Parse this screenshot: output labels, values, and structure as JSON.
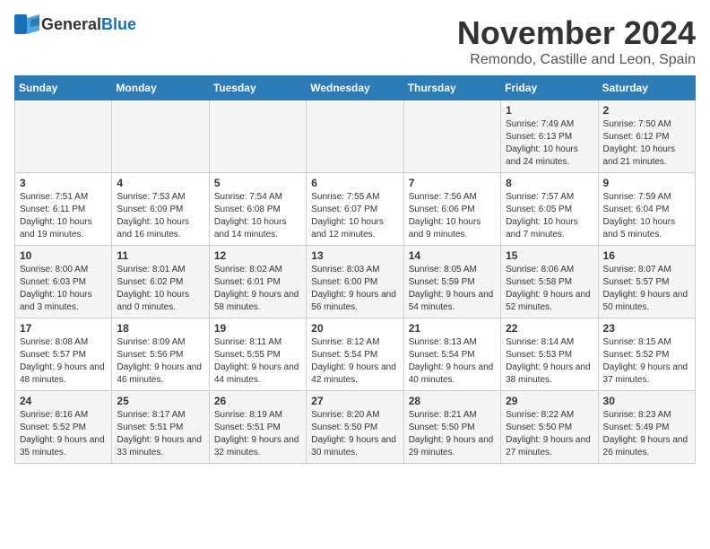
{
  "logo": {
    "general": "General",
    "blue": "Blue"
  },
  "title": "November 2024",
  "location": "Remondo, Castille and Leon, Spain",
  "days_of_week": [
    "Sunday",
    "Monday",
    "Tuesday",
    "Wednesday",
    "Thursday",
    "Friday",
    "Saturday"
  ],
  "weeks": [
    [
      {
        "day": "",
        "content": ""
      },
      {
        "day": "",
        "content": ""
      },
      {
        "day": "",
        "content": ""
      },
      {
        "day": "",
        "content": ""
      },
      {
        "day": "",
        "content": ""
      },
      {
        "day": "1",
        "content": "Sunrise: 7:49 AM\nSunset: 6:13 PM\nDaylight: 10 hours and 24 minutes."
      },
      {
        "day": "2",
        "content": "Sunrise: 7:50 AM\nSunset: 6:12 PM\nDaylight: 10 hours and 21 minutes."
      }
    ],
    [
      {
        "day": "3",
        "content": "Sunrise: 7:51 AM\nSunset: 6:11 PM\nDaylight: 10 hours and 19 minutes."
      },
      {
        "day": "4",
        "content": "Sunrise: 7:53 AM\nSunset: 6:09 PM\nDaylight: 10 hours and 16 minutes."
      },
      {
        "day": "5",
        "content": "Sunrise: 7:54 AM\nSunset: 6:08 PM\nDaylight: 10 hours and 14 minutes."
      },
      {
        "day": "6",
        "content": "Sunrise: 7:55 AM\nSunset: 6:07 PM\nDaylight: 10 hours and 12 minutes."
      },
      {
        "day": "7",
        "content": "Sunrise: 7:56 AM\nSunset: 6:06 PM\nDaylight: 10 hours and 9 minutes."
      },
      {
        "day": "8",
        "content": "Sunrise: 7:57 AM\nSunset: 6:05 PM\nDaylight: 10 hours and 7 minutes."
      },
      {
        "day": "9",
        "content": "Sunrise: 7:59 AM\nSunset: 6:04 PM\nDaylight: 10 hours and 5 minutes."
      }
    ],
    [
      {
        "day": "10",
        "content": "Sunrise: 8:00 AM\nSunset: 6:03 PM\nDaylight: 10 hours and 3 minutes."
      },
      {
        "day": "11",
        "content": "Sunrise: 8:01 AM\nSunset: 6:02 PM\nDaylight: 10 hours and 0 minutes."
      },
      {
        "day": "12",
        "content": "Sunrise: 8:02 AM\nSunset: 6:01 PM\nDaylight: 9 hours and 58 minutes."
      },
      {
        "day": "13",
        "content": "Sunrise: 8:03 AM\nSunset: 6:00 PM\nDaylight: 9 hours and 56 minutes."
      },
      {
        "day": "14",
        "content": "Sunrise: 8:05 AM\nSunset: 5:59 PM\nDaylight: 9 hours and 54 minutes."
      },
      {
        "day": "15",
        "content": "Sunrise: 8:06 AM\nSunset: 5:58 PM\nDaylight: 9 hours and 52 minutes."
      },
      {
        "day": "16",
        "content": "Sunrise: 8:07 AM\nSunset: 5:57 PM\nDaylight: 9 hours and 50 minutes."
      }
    ],
    [
      {
        "day": "17",
        "content": "Sunrise: 8:08 AM\nSunset: 5:57 PM\nDaylight: 9 hours and 48 minutes."
      },
      {
        "day": "18",
        "content": "Sunrise: 8:09 AM\nSunset: 5:56 PM\nDaylight: 9 hours and 46 minutes."
      },
      {
        "day": "19",
        "content": "Sunrise: 8:11 AM\nSunset: 5:55 PM\nDaylight: 9 hours and 44 minutes."
      },
      {
        "day": "20",
        "content": "Sunrise: 8:12 AM\nSunset: 5:54 PM\nDaylight: 9 hours and 42 minutes."
      },
      {
        "day": "21",
        "content": "Sunrise: 8:13 AM\nSunset: 5:54 PM\nDaylight: 9 hours and 40 minutes."
      },
      {
        "day": "22",
        "content": "Sunrise: 8:14 AM\nSunset: 5:53 PM\nDaylight: 9 hours and 38 minutes."
      },
      {
        "day": "23",
        "content": "Sunrise: 8:15 AM\nSunset: 5:52 PM\nDaylight: 9 hours and 37 minutes."
      }
    ],
    [
      {
        "day": "24",
        "content": "Sunrise: 8:16 AM\nSunset: 5:52 PM\nDaylight: 9 hours and 35 minutes."
      },
      {
        "day": "25",
        "content": "Sunrise: 8:17 AM\nSunset: 5:51 PM\nDaylight: 9 hours and 33 minutes."
      },
      {
        "day": "26",
        "content": "Sunrise: 8:19 AM\nSunset: 5:51 PM\nDaylight: 9 hours and 32 minutes."
      },
      {
        "day": "27",
        "content": "Sunrise: 8:20 AM\nSunset: 5:50 PM\nDaylight: 9 hours and 30 minutes."
      },
      {
        "day": "28",
        "content": "Sunrise: 8:21 AM\nSunset: 5:50 PM\nDaylight: 9 hours and 29 minutes."
      },
      {
        "day": "29",
        "content": "Sunrise: 8:22 AM\nSunset: 5:50 PM\nDaylight: 9 hours and 27 minutes."
      },
      {
        "day": "30",
        "content": "Sunrise: 8:23 AM\nSunset: 5:49 PM\nDaylight: 9 hours and 26 minutes."
      }
    ]
  ]
}
